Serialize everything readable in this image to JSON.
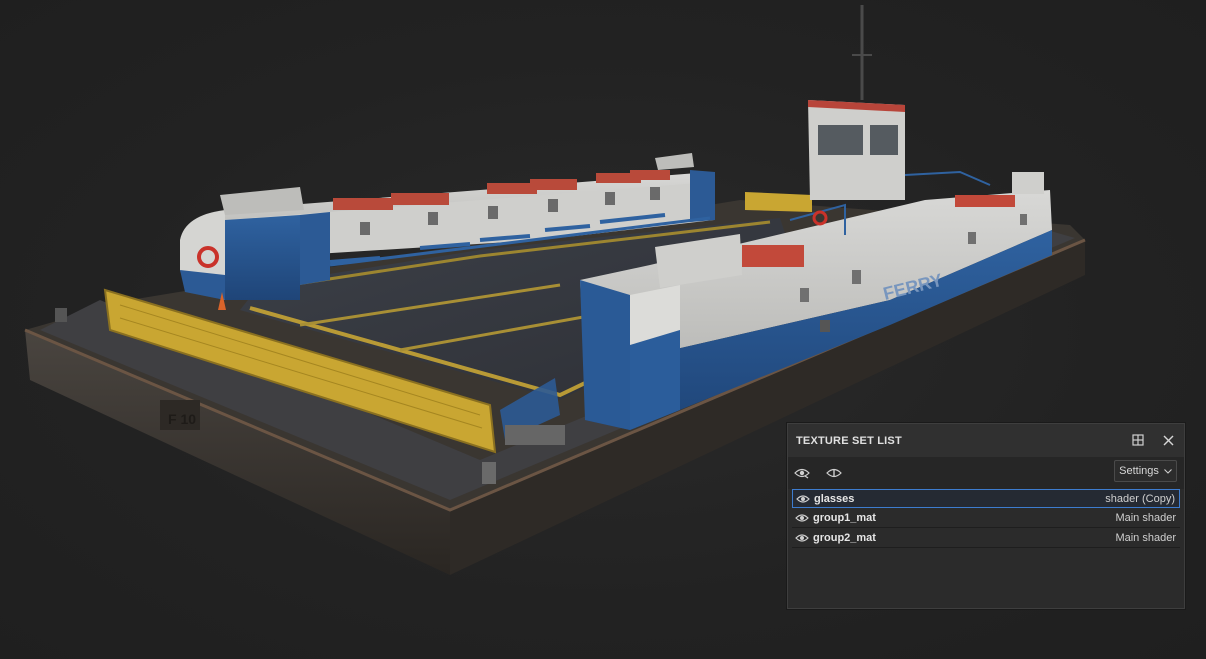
{
  "panel": {
    "title": "TEXTURE SET LIST",
    "dock_icon": "dock-icon",
    "close_icon": "close-icon"
  },
  "toolbar": {
    "visibility_icon": "eye-refresh-icon",
    "info_icon": "info-icon",
    "settings_label": "Settings"
  },
  "texture_sets": [
    {
      "name": "glasses",
      "shader": "shader (Copy)",
      "selected": true
    },
    {
      "name": "group1_mat",
      "shader": "Main shader",
      "selected": false
    },
    {
      "name": "group2_mat",
      "shader": "Main shader",
      "selected": false
    }
  ],
  "model": {
    "hull_marking": "F 10",
    "side_text": "FERRY"
  },
  "colors": {
    "accent": "#3d7ccf",
    "hull_blue": "#2f5f9a",
    "deck_yellow": "#c9a632",
    "panel_bg": "#2b2b2b"
  }
}
